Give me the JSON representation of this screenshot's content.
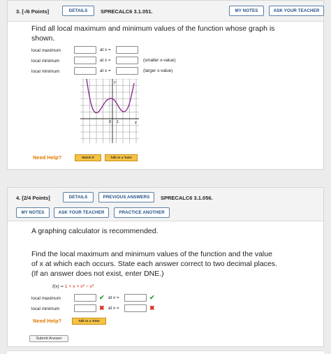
{
  "q1": {
    "number": "3.",
    "points": "[-/6 Points]",
    "details": "DETAILS",
    "code": "SPRECALC6 3.1.051.",
    "my_notes": "MY NOTES",
    "ask_teacher": "ASK YOUR TEACHER",
    "prompt_line1": "Find all local maximum and minimum values of the function whose graph is",
    "prompt_line2": "shown.",
    "rows": [
      {
        "label": "local maximum",
        "at": "at x =",
        "note": ""
      },
      {
        "label": "local minimum",
        "at": "at x =",
        "note": "(smaller x-value)"
      },
      {
        "label": "local minimum",
        "at": "at x =",
        "note": "(larger x-value)"
      }
    ],
    "graph": {
      "y_label": "y",
      "x_label": "x",
      "origin": "0",
      "one": "1"
    },
    "need_help": "Need Help?",
    "watch_it": "Watch It",
    "talk_tutor": "Talk to a Tutor"
  },
  "q2": {
    "number": "4.",
    "points": "[2/4 Points]",
    "details": "DETAILS",
    "previous_answers": "PREVIOUS ANSWERS",
    "code": "SPRECALC6 3.1.056.",
    "my_notes": "MY NOTES",
    "ask_teacher": "ASK YOUR TEACHER",
    "practice_another": "PRACTICE ANOTHER",
    "calc_note": "A graphing calculator is recommended.",
    "prompt_line1": "Find the local maximum and minimum values of the function and the value",
    "prompt_line2": "of x at which each occurs. State each answer correct to two decimal places.",
    "prompt_line3": "(If an answer does not exist, enter DNE.)",
    "function": {
      "lhs": "f(x) = ",
      "rhs": "1 + x + x² − x³"
    },
    "rows": [
      {
        "label": "local maximum",
        "value_status": "correct",
        "at": "at x =",
        "x_status": "correct"
      },
      {
        "label": "local minimum",
        "value_status": "incorrect",
        "at": "at x =",
        "x_status": "incorrect"
      }
    ],
    "need_help": "Need Help?",
    "talk_tutor": "Talk to a Tutor"
  },
  "submit": "Submit Answer",
  "colors": {
    "accent": "#1f4f86",
    "help": "#e07a00",
    "curve": "#8b2f8f",
    "correct": "#2f9d2f",
    "incorrect": "#d9261c"
  }
}
